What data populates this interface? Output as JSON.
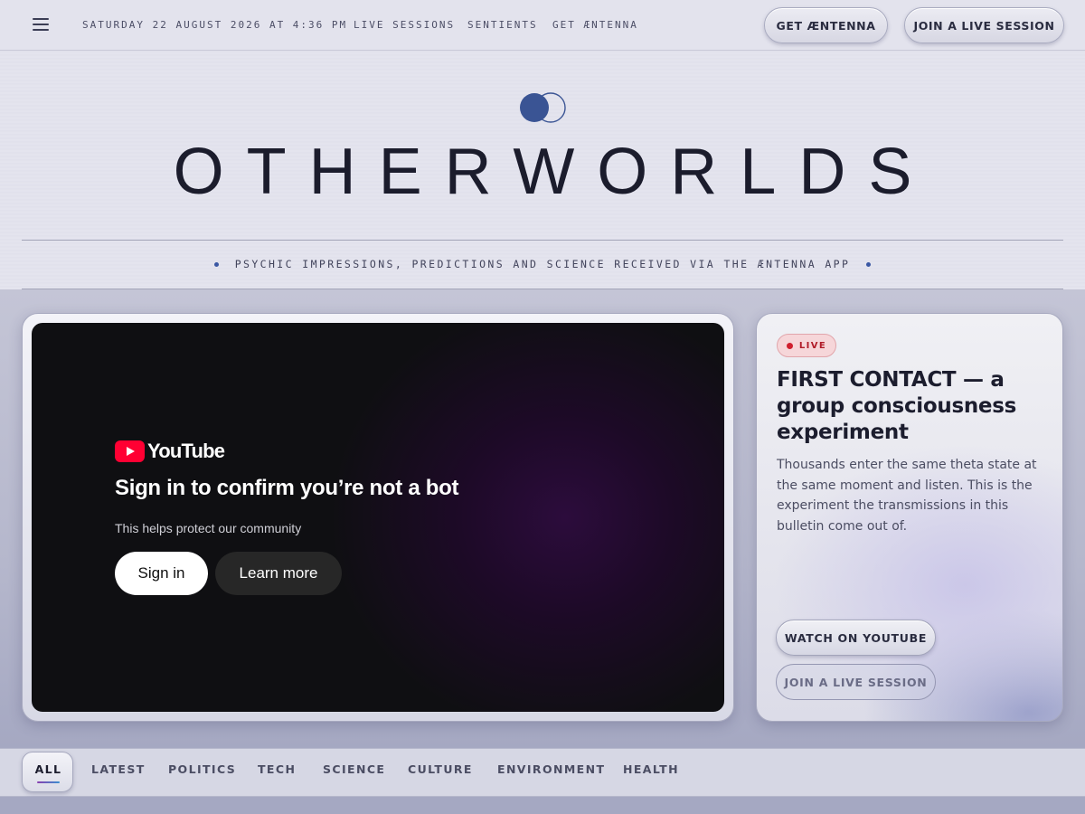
{
  "topbar": {
    "date": "SATURDAY 22 AUGUST 2026 AT 4:36 PM",
    "links": [
      "LIVE SESSIONS",
      "SENTIENTS",
      "GET ÆNTENNA"
    ],
    "get_button": "GET ÆNTENNA",
    "join_button": "JOIN A LIVE SESSION"
  },
  "hero": {
    "wordmark": "OTHERWORLDS",
    "tagline": "PSYCHIC IMPRESSIONS, PREDICTIONS AND SCIENCE RECEIVED VIA THE ÆNTENNA APP"
  },
  "video": {
    "brand": "YouTube",
    "heading": "Sign in to confirm you’re not a bot",
    "subtext": "This helps protect our community",
    "signin_label": "Sign in",
    "learn_label": "Learn more"
  },
  "feature": {
    "badge": "LIVE",
    "title": "FIRST CONTACT — a group consciousness experiment",
    "description": "Thousands enter the same theta state at the same moment and listen. This is the experiment the transmissions in this bulletin come out of.",
    "watch_label": "WATCH ON YOUTUBE",
    "join_label": "JOIN A LIVE SESSION"
  },
  "categories": {
    "active": "ALL",
    "items": [
      "LATEST",
      "POLITICS",
      "TECH",
      "SCIENCE",
      "CULTURE",
      "ENVIRONMENT",
      "HEALTH"
    ]
  },
  "colors": {
    "accent_blue": "#3a57a3",
    "live_red": "#d0202f",
    "youtube_red": "#ff0033"
  }
}
